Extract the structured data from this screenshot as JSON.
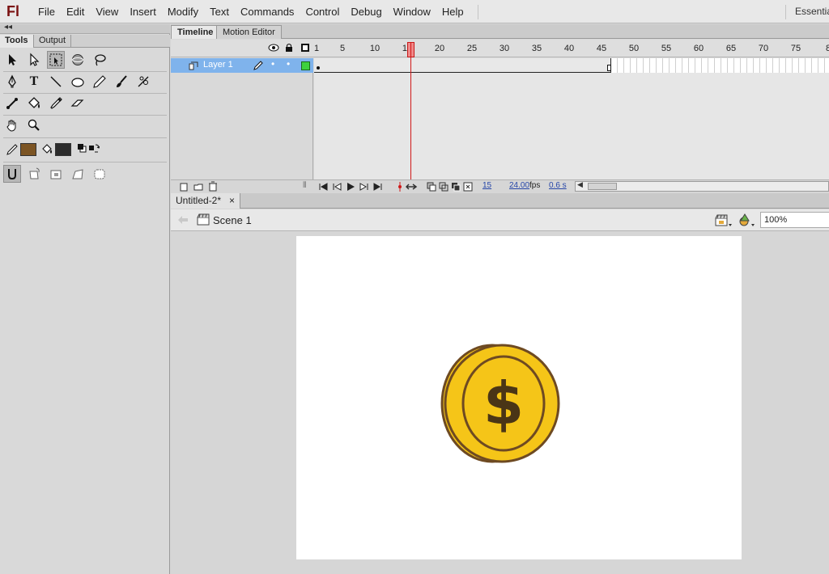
{
  "app": {
    "logo": "Fl"
  },
  "menu": [
    "File",
    "Edit",
    "View",
    "Insert",
    "Modify",
    "Text",
    "Commands",
    "Control",
    "Debug",
    "Window",
    "Help"
  ],
  "workspace_label": "Essentia",
  "tools_panel": {
    "tabs": [
      "Tools",
      "Output"
    ],
    "rows": [
      [
        "selection-tool-icon",
        "subselection-tool-icon",
        "free-transform-tool-icon",
        "3d-rotation-tool-icon",
        "lasso-tool-icon"
      ],
      [
        "pen-tool-icon",
        "text-tool-icon",
        "line-tool-icon",
        "oval-tool-icon",
        "pencil-tool-icon",
        "brush-tool-icon",
        "deco-tool-icon"
      ],
      [
        "bone-tool-icon",
        "paint-bucket-tool-icon",
        "eyedropper-tool-icon",
        "eraser-tool-icon"
      ],
      [
        "hand-tool-icon",
        "zoom-tool-icon"
      ]
    ],
    "stroke_color": "#7c5524",
    "fill_color": "#2c2c2c",
    "text_tool_glyph": "T"
  },
  "timeline": {
    "tabs": [
      "Timeline",
      "Motion Editor"
    ],
    "layer_name": "Layer 1",
    "frame_numbers": [
      "1",
      "5",
      "10",
      "15",
      "20",
      "25",
      "30",
      "35",
      "40",
      "45",
      "50",
      "55",
      "60",
      "65",
      "70",
      "75",
      "8"
    ],
    "current_frame": "15",
    "fps": "24.00",
    "fps_unit": "fps",
    "elapsed": "0.6 s",
    "total_frames": 46,
    "playhead_frame": 15
  },
  "document": {
    "tab_title": "Untitled-2*",
    "close_glyph": "×",
    "scene": "Scene 1",
    "zoom": "100%",
    "coin_symbol": "$"
  },
  "colors": {
    "coin_fill": "#f5c518",
    "coin_outline": "#6e4a22",
    "dollar": "#4a3516",
    "layer_highlight": "#7fb3ec",
    "playhead": "#d01818"
  }
}
